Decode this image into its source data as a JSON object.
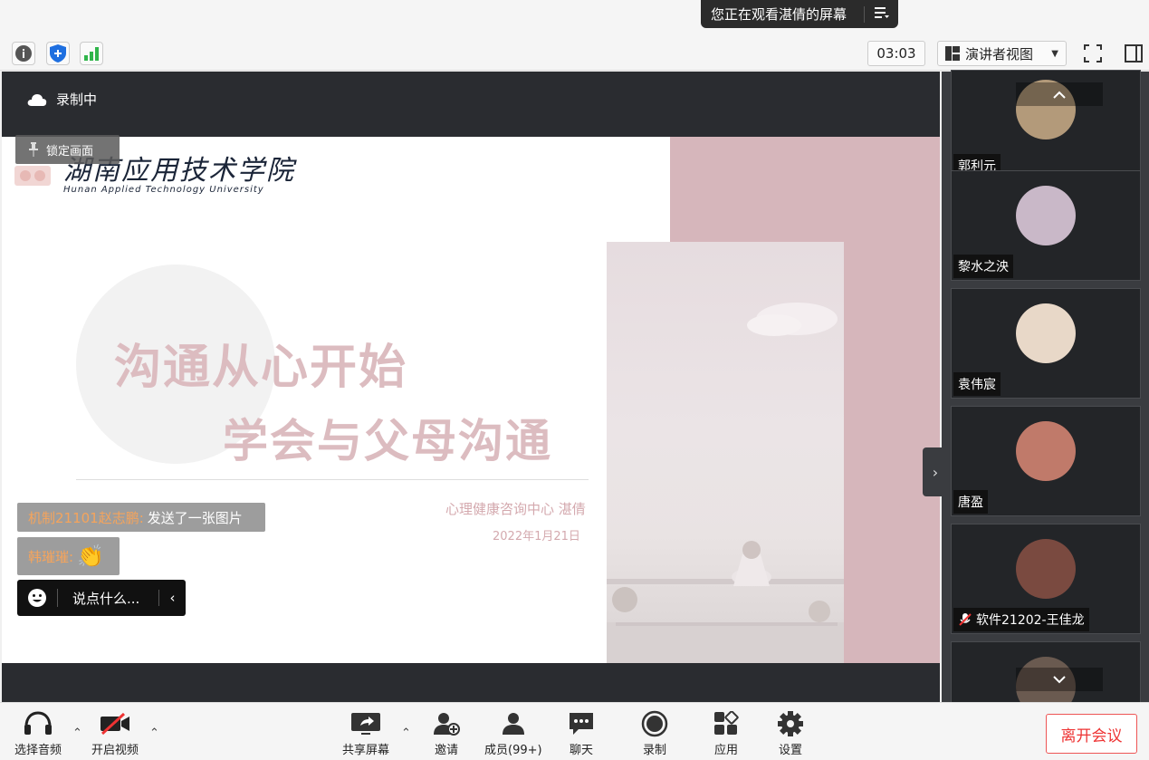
{
  "banner": {
    "watching_text": "您正在观看湛倩的屏幕",
    "menu_icon": "list-menu-icon"
  },
  "toolbar": {
    "timer": "03:03",
    "view_mode": "演讲者视图"
  },
  "main": {
    "recording_label": "录制中",
    "lock_label": "锁定画面",
    "slide": {
      "logo_text": "湖南应用技术学院",
      "logo_sub": "Hunan Applied Technology University",
      "title1": "沟通从心开始",
      "title2": "学会与父母沟通",
      "presenter": "心理健康咨询中心 湛倩",
      "date": "2022年1月21日"
    },
    "chat": {
      "msg1_name": "机制21101赵志鹏:",
      "msg1_text": "发送了一张图片",
      "msg2_name": "韩璀璀:",
      "msg2_emoji": "👏",
      "input_placeholder": "说点什么..."
    }
  },
  "participants": [
    {
      "name": "郭利元",
      "color": "#b39a7a"
    },
    {
      "name": "黎水之泱",
      "color": "#c9b8c8"
    },
    {
      "name": "袁伟宸",
      "color": "#e8d8c8"
    },
    {
      "name": "唐盈",
      "color": "#c07a6a"
    },
    {
      "name": "软件21202-王佳龙",
      "color": "#7a4a40",
      "muted": true
    }
  ],
  "bottom": {
    "audio": "选择音频",
    "video": "开启视频",
    "share": "共享屏幕",
    "invite": "邀请",
    "members": "成员(99+)",
    "chat": "聊天",
    "record": "录制",
    "apps": "应用",
    "settings": "设置",
    "leave": "离开会议"
  }
}
